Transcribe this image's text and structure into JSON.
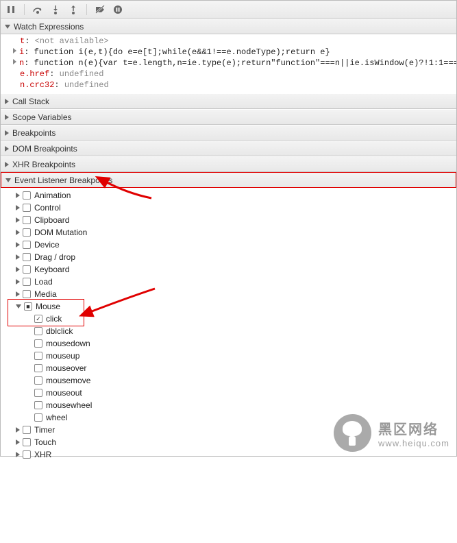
{
  "toolbar": {
    "icons": [
      "pause",
      "step-over",
      "step-into",
      "step-out",
      "deactivate-breakpoints",
      "pause-on-exceptions"
    ]
  },
  "panels": {
    "watch": {
      "title": "Watch Expressions",
      "items": [
        {
          "key": "t",
          "value": "<not available>",
          "kind": "na"
        },
        {
          "key": "i",
          "value": "function i(e,t){do e=e[t];while(e&&1!==e.nodeType);return e}",
          "kind": "fn",
          "disc": true
        },
        {
          "key": "n",
          "value": "function n(e){var t=e.length,n=ie.type(e);return\"function\"===n||ie.isWindow(e)?!1:1===…",
          "kind": "fn",
          "disc": true
        },
        {
          "key": "e.href",
          "value": "undefined",
          "kind": "undef"
        },
        {
          "key": "n.crc32",
          "value": "undefined",
          "kind": "undef"
        }
      ]
    },
    "callstack": {
      "title": "Call Stack"
    },
    "scope": {
      "title": "Scope Variables"
    },
    "bp": {
      "title": "Breakpoints"
    },
    "dombp": {
      "title": "DOM Breakpoints"
    },
    "xhrbp": {
      "title": "XHR Breakpoints"
    },
    "elbp": {
      "title": "Event Listener Breakpoints"
    }
  },
  "eventCats": [
    {
      "label": "Animation",
      "expanded": false,
      "checked": false
    },
    {
      "label": "Control",
      "expanded": false,
      "checked": false
    },
    {
      "label": "Clipboard",
      "expanded": false,
      "checked": false
    },
    {
      "label": "DOM Mutation",
      "expanded": false,
      "checked": false
    },
    {
      "label": "Device",
      "expanded": false,
      "checked": false
    },
    {
      "label": "Drag / drop",
      "expanded": false,
      "checked": false
    },
    {
      "label": "Keyboard",
      "expanded": false,
      "checked": false
    },
    {
      "label": "Load",
      "expanded": false,
      "checked": false
    },
    {
      "label": "Media",
      "expanded": false,
      "checked": false
    },
    {
      "label": "Mouse",
      "expanded": true,
      "checked": "mixed",
      "children": [
        {
          "label": "click",
          "checked": true
        },
        {
          "label": "dblclick",
          "checked": false
        },
        {
          "label": "mousedown",
          "checked": false
        },
        {
          "label": "mouseup",
          "checked": false
        },
        {
          "label": "mouseover",
          "checked": false
        },
        {
          "label": "mousemove",
          "checked": false
        },
        {
          "label": "mouseout",
          "checked": false
        },
        {
          "label": "mousewheel",
          "checked": false
        },
        {
          "label": "wheel",
          "checked": false
        }
      ]
    },
    {
      "label": "Timer",
      "expanded": false,
      "checked": false
    },
    {
      "label": "Touch",
      "expanded": false,
      "checked": false
    },
    {
      "label": "XHR",
      "expanded": false,
      "checked": false
    }
  ],
  "watermark": {
    "cn": "黑区网络",
    "url": "www.heiqu.com"
  }
}
